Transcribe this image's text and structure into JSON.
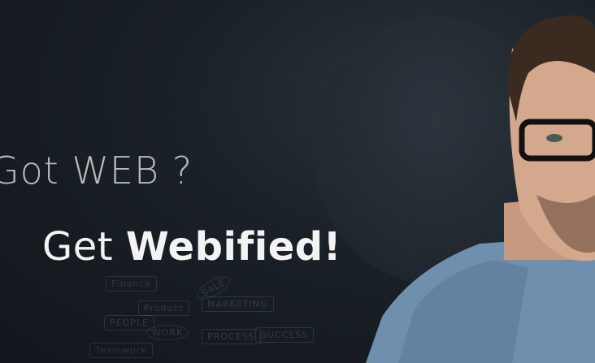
{
  "headline": {
    "line1": "Got WEB ?",
    "line2_prefix": "Get",
    "line2_brand": "Webified!"
  },
  "sketch_labels": [
    "Finance",
    "SALE",
    "Product",
    "MARKETING",
    "PEOPLE",
    "WORK",
    "PROCESS",
    "SUCCESS",
    "Teamwork"
  ],
  "colors": {
    "background": "#14191f",
    "headline1": "#b9babb",
    "headline2": "#f3f3f3",
    "shirt": "#6f8fae"
  }
}
